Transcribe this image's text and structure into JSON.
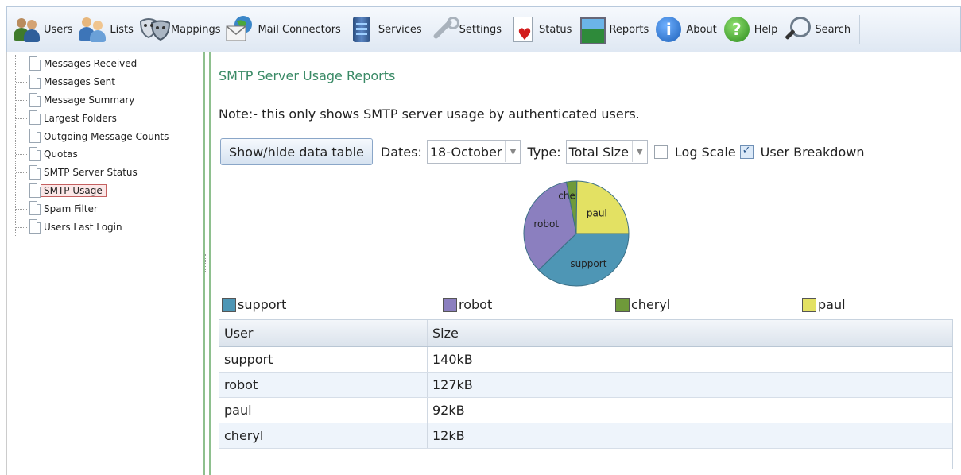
{
  "toolbar": {
    "items": [
      {
        "label": "Users",
        "icon": "users-icon"
      },
      {
        "label": "Lists",
        "icon": "lists-icon"
      },
      {
        "label": "Mappings",
        "icon": "mappings-icon"
      },
      {
        "label": "Mail Connectors",
        "icon": "mail-connectors-icon"
      },
      {
        "label": "Services",
        "icon": "services-icon"
      },
      {
        "label": "Settings",
        "icon": "settings-icon"
      },
      {
        "label": "Status",
        "icon": "status-icon"
      },
      {
        "label": "Reports",
        "icon": "reports-icon"
      },
      {
        "label": "About",
        "icon": "about-icon"
      },
      {
        "label": "Help",
        "icon": "help-icon"
      },
      {
        "label": "Search",
        "icon": "search-icon"
      }
    ]
  },
  "sidebar": {
    "items": [
      {
        "label": "Messages Received"
      },
      {
        "label": "Messages Sent"
      },
      {
        "label": "Message Summary"
      },
      {
        "label": "Largest Folders"
      },
      {
        "label": "Outgoing Message Counts"
      },
      {
        "label": "Quotas"
      },
      {
        "label": "SMTP Server Status"
      },
      {
        "label": "SMTP Usage",
        "selected": true
      },
      {
        "label": "Spam Filter"
      },
      {
        "label": "Users Last Login"
      }
    ]
  },
  "main": {
    "title": "SMTP Server Usage Reports",
    "note": "Note:- this only shows SMTP server usage by authenticated users.",
    "show_hide_label": "Show/hide data table",
    "dates_label": "Dates:",
    "dates_value": "18-October",
    "type_label": "Type:",
    "type_value": "Total Size",
    "log_scale_label": "Log Scale",
    "log_scale_checked": false,
    "user_breakdown_label": "User Breakdown",
    "user_breakdown_checked": true
  },
  "chart_data": {
    "type": "pie",
    "slices": [
      {
        "label": "support",
        "value": 140,
        "color": "#4e96b5"
      },
      {
        "label": "robot",
        "value": 127,
        "color": "#8b7fbf"
      },
      {
        "label": "cheryl",
        "value": 12,
        "color": "#6f9a3a"
      },
      {
        "label": "paul",
        "value": 92,
        "color": "#e3e163"
      }
    ],
    "legend_position": "bottom"
  },
  "table": {
    "headers": [
      "User",
      "Size"
    ],
    "rows": [
      [
        "support",
        "140kB"
      ],
      [
        "robot",
        "127kB"
      ],
      [
        "paul",
        "92kB"
      ],
      [
        "cheryl",
        "12kB"
      ]
    ]
  }
}
